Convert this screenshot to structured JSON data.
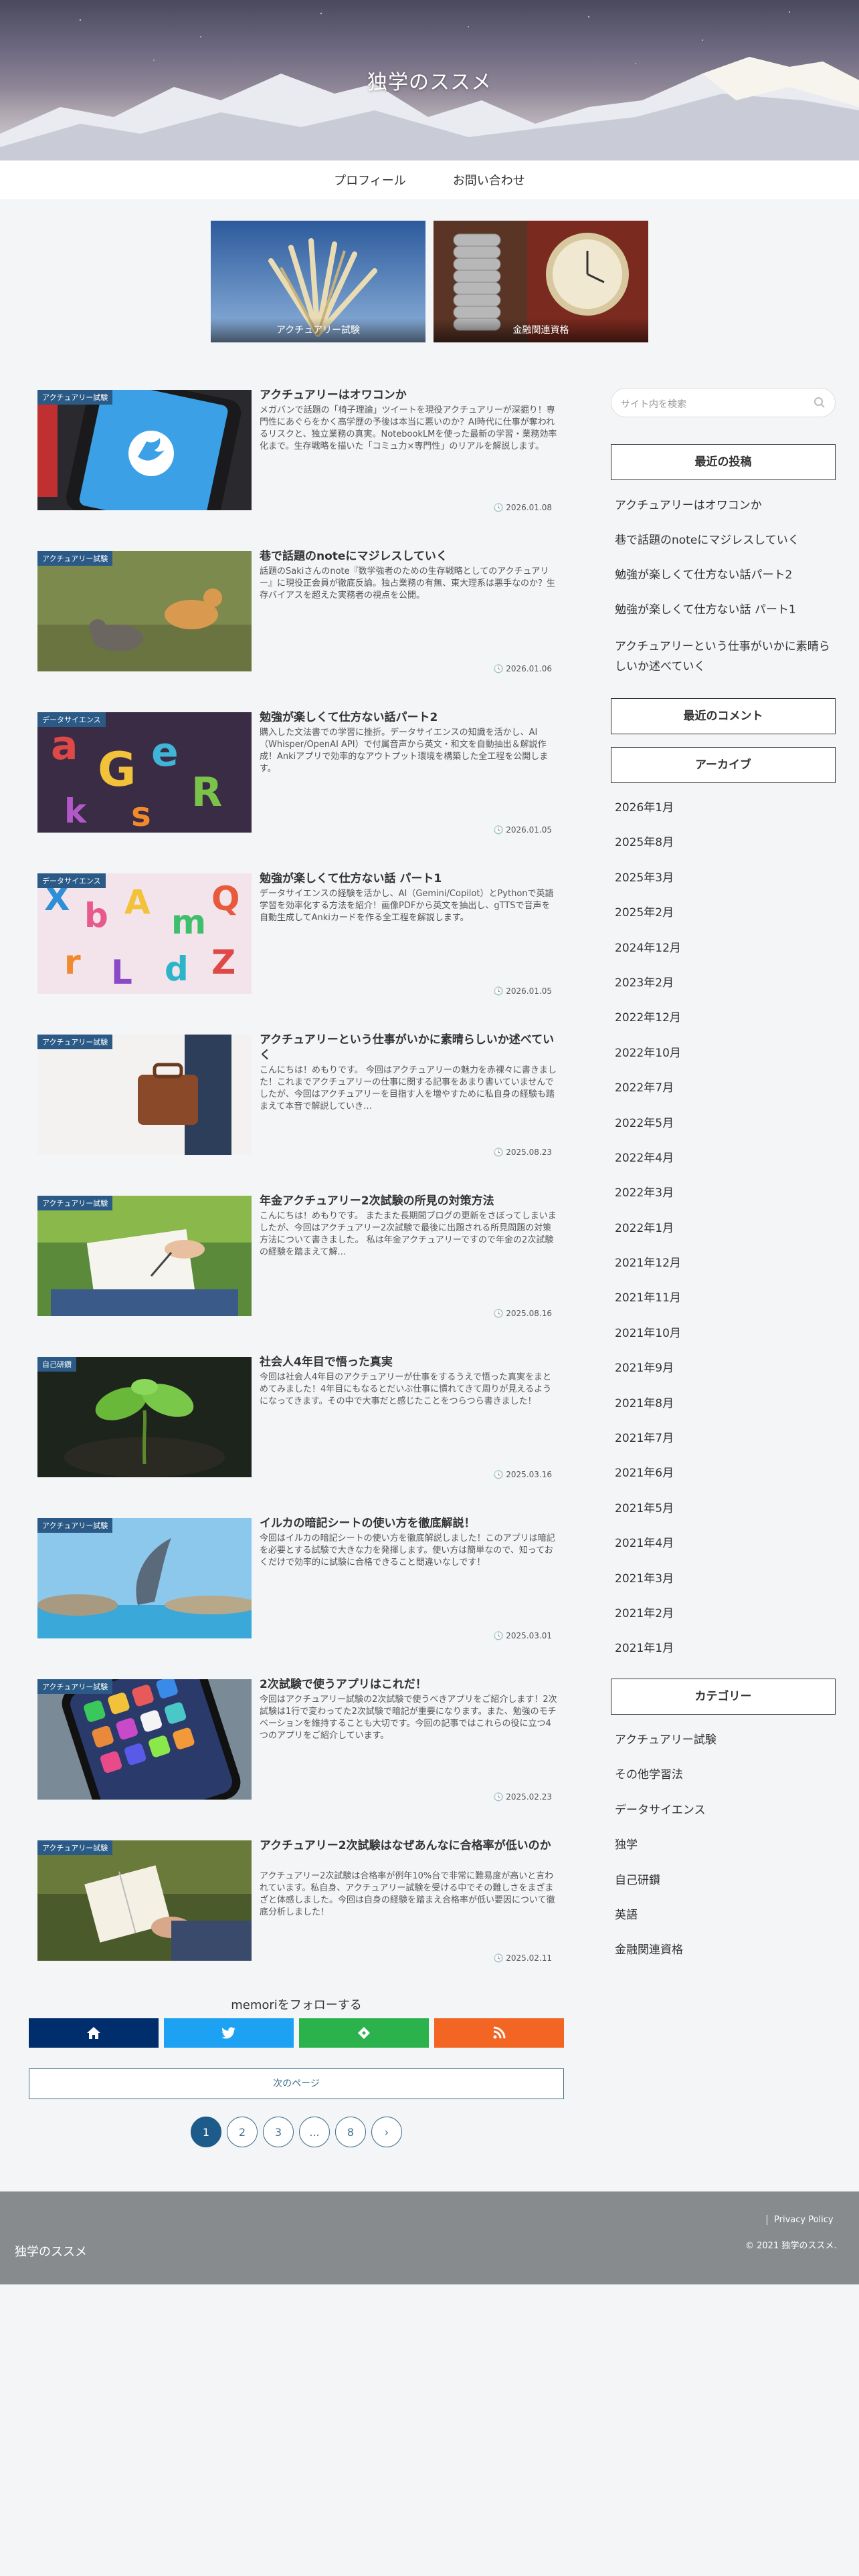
{
  "site": {
    "title": "独学のススメ"
  },
  "nav": [
    {
      "label": "プロフィール"
    },
    {
      "label": "お問い合わせ"
    }
  ],
  "carousel": [
    {
      "label": "アクチュアリー試験"
    },
    {
      "label": "金融関連資格"
    }
  ],
  "posts": [
    {
      "category": "アクチュアリー試験",
      "title": "アクチュアリーはオワコンか",
      "snippet": "メガバンで話題の「椅子理論」ツイートを現役アクチュアリーが深掘り！専門性にあぐらをかく高学歴の予後は本当に悪いのか？AI時代に仕事が奪われるリスクと、独立業務の真実。NotebookLMを使った最新の学習・業務効率化まで。生存戦略を描いた「コミュ力×専門性」のリアルを解説します。",
      "date": "2026.01.08"
    },
    {
      "category": "アクチュアリー試験",
      "title": "巷で話題のnoteにマジレスしていく",
      "snippet": "話題のSakiさんのnote『数学強者のための生存戦略としてのアクチュアリー』に現役正会員が徹底反論。独占業務の有無、東大理系は悪手なのか？生存バイアスを超えた実務者の視点を公開。",
      "date": "2026.01.06"
    },
    {
      "category": "データサイエンス",
      "title": "勉強が楽しくて仕方ない話パート2",
      "snippet": "購入した文法書での学習に挫折。データサイエンスの知識を活かし、AI（Whisper/OpenAI API）で付属音声から英文・和文を自動抽出＆解説作成！Ankiアプリで効率的なアウトプット環境を構築した全工程を公開します。",
      "date": "2026.01.05"
    },
    {
      "category": "データサイエンス",
      "title": "勉強が楽しくて仕方ない話 パート1",
      "snippet": "データサイエンスの経験を活かし、AI（Gemini/Copilot）とPythonで英語学習を効率化する方法を紹介！画像PDFから英文を抽出し、gTTSで音声を自動生成してAnkiカードを作る全工程を解説します。",
      "date": "2026.01.05"
    },
    {
      "category": "アクチュアリー試験",
      "title": "アクチュアリーという仕事がいかに素晴らしいか述べていく",
      "snippet": "こんにちは！めもりです。 今回はアクチュアリーの魅力を赤裸々に書きました！これまでアクチュアリーの仕事に関する記事をあまり書いていませんでしたが、今回はアクチュアリーを目指す人を増やすために私自身の経験も踏まえて本音で解説していき…",
      "date": "2025.08.23"
    },
    {
      "category": "アクチュアリー試験",
      "title": "年金アクチュアリー2次試験の所見の対策方法",
      "snippet": "こんにちは！めもりです。 またまた長期間ブログの更新をさぼってしまいましたが、今回はアクチュアリー2次試験で最後に出題される所見問題の対策方法について書きました。 私は年金アクチュアリーですので年金の2次試験の経験を踏まえて解…",
      "date": "2025.08.16"
    },
    {
      "category": "自己研鑽",
      "title": "社会人4年目で悟った真実",
      "snippet": "今回は社会人4年目のアクチュアリーが仕事をするうえで悟った真実をまとめてみました！4年目にもなるとだいぶ仕事に慣れてきて周りが見えるようになってきます。その中で大事だと感じたことをつらつら書きました！",
      "date": "2025.03.16"
    },
    {
      "category": "アクチュアリー試験",
      "title": "イルカの暗記シートの使い方を徹底解説！",
      "snippet": "今回はイルカの暗記シートの使い方を徹底解説しました！このアプリは暗記を必要とする試験で大きな力を発揮します。使い方は簡単なので、知っておくだけで効率的に試験に合格できること間違いなしです！",
      "date": "2025.03.01"
    },
    {
      "category": "アクチュアリー試験",
      "title": "2次試験で使うアプリはこれだ！",
      "snippet": "今回はアクチュアリー試験の2次試験で使うべきアプリをご紹介します！2次試験は1行で変わってた2次試験で暗記が重要になります。また、勉強のモチベーションを維持することも大切です。今回の記事ではこれらの役に立つ4つのアプリをご紹介しています。",
      "date": "2025.02.23"
    },
    {
      "category": "アクチュアリー試験",
      "title": "アクチュアリー2次試験はなぜあんなに合格率が低いのか",
      "snippet": "アクチュアリー2次試験は合格率が例年10%台で非常に難易度が高いと言われています。私自身、アクチュアリー試験を受ける中でその難しさをまざまざと体感しました。今回は自身の経験を踏まえ合格率が低い要因について徹底分析しました！",
      "date": "2025.02.11"
    }
  ],
  "follow": {
    "title": "memoriをフォローする",
    "buttons": [
      {
        "icon": "home-icon",
        "color": "#002d6b"
      },
      {
        "icon": "twitter-icon",
        "color": "#1da1f2"
      },
      {
        "icon": "feedly-icon",
        "color": "#2bb24c"
      },
      {
        "icon": "rss-icon",
        "color": "#f26522"
      }
    ]
  },
  "pagination": {
    "next_label": "次のページ",
    "pages": [
      "1",
      "2",
      "3",
      "...",
      "8",
      "›"
    ]
  },
  "sidebar": {
    "search_placeholder": "サイト内を検索",
    "recent_posts_title": "最近の投稿",
    "recent_posts": [
      "アクチュアリーはオワコンか",
      "巷で話題のnoteにマジレスしていく",
      "勉強が楽しくて仕方ない話パート2",
      "勉強が楽しくて仕方ない話 パート1",
      "アクチュアリーという仕事がいかに素晴らしいか述べていく"
    ],
    "recent_comments_title": "最近のコメント",
    "archive_title": "アーカイブ",
    "archives": [
      "2026年1月",
      "2025年8月",
      "2025年3月",
      "2025年2月",
      "2024年12月",
      "2023年2月",
      "2022年12月",
      "2022年10月",
      "2022年7月",
      "2022年5月",
      "2022年4月",
      "2022年3月",
      "2022年1月",
      "2021年12月",
      "2021年11月",
      "2021年10月",
      "2021年9月",
      "2021年8月",
      "2021年7月",
      "2021年6月",
      "2021年5月",
      "2021年4月",
      "2021年3月",
      "2021年2月",
      "2021年1月"
    ],
    "category_title": "カテゴリー",
    "categories": [
      "アクチュアリー試験",
      "その他学習法",
      "データサイエンス",
      "独学",
      "自己研鑽",
      "英語",
      "金融関連資格"
    ]
  },
  "footer": {
    "site_name": "独学のススメ",
    "privacy": "Privacy Policy",
    "copyright": "© 2021 独学のススメ."
  }
}
